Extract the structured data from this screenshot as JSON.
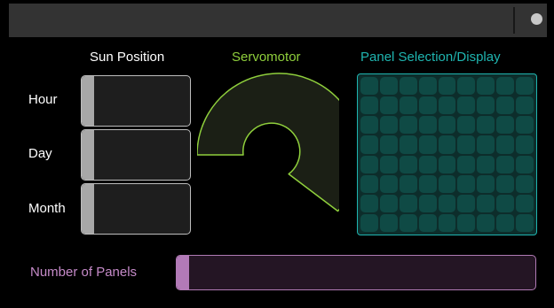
{
  "sections": {
    "sun_position": "Sun Position",
    "servomotor": "Servomotor",
    "panel_display": "Panel Selection/Display"
  },
  "sun_controls": [
    {
      "label": "Hour"
    },
    {
      "label": "Day"
    },
    {
      "label": "Month"
    }
  ],
  "panels": {
    "label": "Number of Panels"
  },
  "matrix": {
    "columns": 9,
    "rows": 8
  },
  "colors": {
    "sun": "#ffffff",
    "servo": "#8fcf3c",
    "panel": "#1fb5b0",
    "panels_slider": "#b27ab7"
  },
  "icons": {
    "window_control": "circle-dot-icon"
  }
}
